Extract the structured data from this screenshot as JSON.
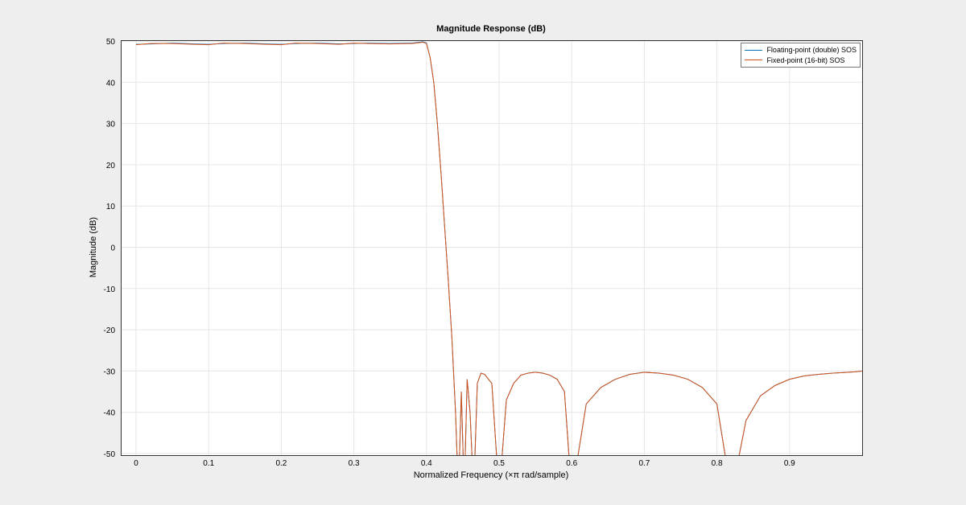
{
  "chart_data": {
    "type": "line",
    "title": "Magnitude Response (dB)",
    "xlabel": "Normalized Frequency  (×π rad/sample)",
    "ylabel": "Magnitude (dB)",
    "xlim": [
      0,
      1.0
    ],
    "ylim": [
      -50,
      50
    ],
    "xticks": [
      0,
      0.1,
      0.2,
      0.3,
      0.4,
      0.5,
      0.6,
      0.7,
      0.8,
      0.9
    ],
    "yticks": [
      -50,
      -40,
      -30,
      -20,
      -10,
      0,
      10,
      20,
      30,
      40,
      50
    ],
    "series": [
      {
        "name": "Floating-point (double) SOS",
        "color": "#0072bd",
        "x": [
          0,
          0.02,
          0.05,
          0.08,
          0.1,
          0.12,
          0.15,
          0.18,
          0.2,
          0.22,
          0.25,
          0.28,
          0.3,
          0.32,
          0.35,
          0.38,
          0.395,
          0.4,
          0.405,
          0.41,
          0.415,
          0.42,
          0.425,
          0.43,
          0.435,
          0.44,
          0.444,
          0.448,
          0.452,
          0.456,
          0.46,
          0.465,
          0.47,
          0.475,
          0.48,
          0.49,
          0.5,
          0.51,
          0.52,
          0.53,
          0.54,
          0.55,
          0.56,
          0.57,
          0.58,
          0.59,
          0.6,
          0.62,
          0.64,
          0.66,
          0.68,
          0.7,
          0.72,
          0.74,
          0.76,
          0.78,
          0.8,
          0.82,
          0.84,
          0.86,
          0.88,
          0.9,
          0.92,
          0.94,
          0.96,
          0.98,
          0.99,
          1.0
        ],
        "y": [
          49.2,
          49.3,
          49.5,
          49.3,
          49.2,
          49.4,
          49.5,
          49.3,
          49.2,
          49.4,
          49.5,
          49.3,
          49.4,
          49.5,
          49.4,
          49.5,
          49.8,
          49.5,
          46,
          40,
          30,
          18,
          5,
          -8,
          -22,
          -40,
          -60,
          -35,
          -60,
          -32,
          -40,
          -60,
          -33,
          -30.5,
          -30.8,
          -33,
          -60,
          -37,
          -33,
          -31,
          -30.5,
          -30.3,
          -30.5,
          -31,
          -32,
          -35,
          -60,
          -38,
          -34,
          -32,
          -30.8,
          -30.3,
          -30.5,
          -31,
          -32,
          -34,
          -38,
          -60,
          -42,
          -36,
          -33.5,
          -32,
          -31.2,
          -30.8,
          -30.5,
          -30.3,
          -30.2,
          -30.0
        ]
      },
      {
        "name": "Fixed-point (16-bit) SOS",
        "color": "#d95319",
        "x": [
          0,
          0.02,
          0.05,
          0.08,
          0.1,
          0.12,
          0.15,
          0.18,
          0.2,
          0.22,
          0.25,
          0.28,
          0.3,
          0.32,
          0.35,
          0.38,
          0.395,
          0.4,
          0.405,
          0.41,
          0.415,
          0.42,
          0.425,
          0.43,
          0.435,
          0.44,
          0.444,
          0.448,
          0.452,
          0.456,
          0.46,
          0.465,
          0.47,
          0.475,
          0.48,
          0.49,
          0.5,
          0.51,
          0.52,
          0.53,
          0.54,
          0.55,
          0.56,
          0.57,
          0.58,
          0.59,
          0.6,
          0.62,
          0.64,
          0.66,
          0.68,
          0.7,
          0.72,
          0.74,
          0.76,
          0.78,
          0.8,
          0.82,
          0.84,
          0.86,
          0.88,
          0.9,
          0.92,
          0.94,
          0.96,
          0.98,
          0.99,
          1.0
        ],
        "y": [
          49.1,
          49.4,
          49.4,
          49.2,
          49.1,
          49.5,
          49.4,
          49.2,
          49.1,
          49.5,
          49.4,
          49.2,
          49.5,
          49.4,
          49.3,
          49.4,
          49.7,
          49.4,
          46,
          40,
          30,
          18,
          5,
          -8,
          -22,
          -40,
          -60,
          -35,
          -60,
          -32,
          -40,
          -60,
          -33,
          -30.5,
          -30.8,
          -33,
          -60,
          -37,
          -33,
          -31,
          -30.5,
          -30.3,
          -30.5,
          -31,
          -32,
          -35,
          -60,
          -38,
          -34,
          -32,
          -30.8,
          -30.3,
          -30.5,
          -31,
          -32,
          -34,
          -38,
          -60,
          -42,
          -36,
          -33.5,
          -32,
          -31.2,
          -30.8,
          -30.5,
          -30.3,
          -30.2,
          -30.0
        ]
      }
    ]
  }
}
